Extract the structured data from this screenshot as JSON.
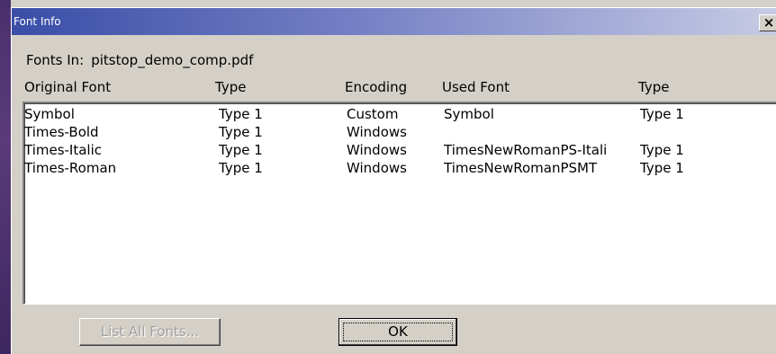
{
  "window": {
    "title": "Font Info",
    "close_symbol": "×"
  },
  "fonts_in": {
    "label": "Fonts In:",
    "filename": "pitstop_demo_comp.pdf"
  },
  "columns": [
    "Original Font",
    "Type",
    "Encoding",
    "Used Font",
    "Type"
  ],
  "rows": [
    {
      "original": "Symbol",
      "type": "Type 1",
      "encoding": "Custom",
      "used": "Symbol",
      "used_type": "Type 1"
    },
    {
      "original": "Times-Bold",
      "type": "Type 1",
      "encoding": "Windows",
      "used": "",
      "used_type": ""
    },
    {
      "original": "Times-Italic",
      "type": "Type 1",
      "encoding": "Windows",
      "used": "TimesNewRomanPS-Itali",
      "used_type": "Type 1"
    },
    {
      "original": "Times-Roman",
      "type": "Type 1",
      "encoding": "Windows",
      "used": "TimesNewRomanPSMT",
      "used_type": "Type 1"
    }
  ],
  "buttons": {
    "list_all_fonts": "List All Fonts...",
    "ok": "OK"
  }
}
